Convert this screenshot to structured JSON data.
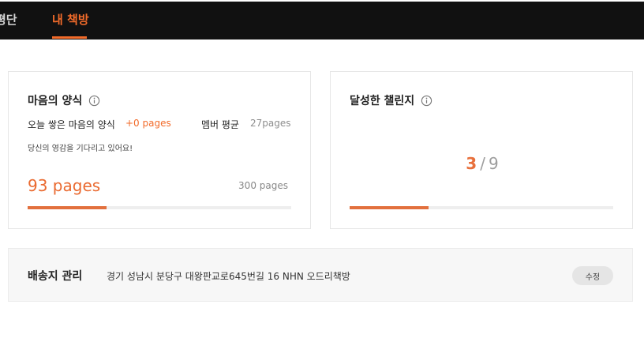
{
  "nav": {
    "tabs": [
      {
        "label": "평단"
      },
      {
        "label": "내 책방"
      }
    ]
  },
  "reading": {
    "title": "마음의 양식",
    "today_label": "오늘 쌓은 마음의 양식",
    "today_value": "+0 pages",
    "member_label": "멤버 평균",
    "member_value": "27pages",
    "encourage": "당신의 영감을 기다리고 있어요!",
    "current": "93 pages",
    "goal": "300 pages",
    "progress_fraction": 0.3
  },
  "challenge": {
    "title": "달성한 챌린지",
    "done": "3",
    "separator": "/",
    "total": "9",
    "progress_fraction": 0.3
  },
  "address": {
    "title": "배송지 관리",
    "text": "경기 성남시 분당구 대왕판교로645번길 16 NHN 오드리책방",
    "edit_label": "수정"
  },
  "colors": {
    "accent": "#f26b2a",
    "topbar": "#111111"
  }
}
